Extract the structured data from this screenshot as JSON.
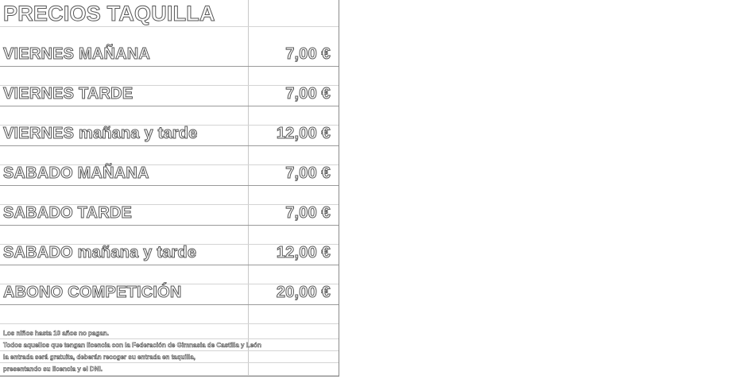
{
  "title": "PRECIOS TAQUILLA",
  "rows": [
    {
      "label": "VIERNES MAÑANA",
      "price": "7,00 €"
    },
    {
      "label": "VIERNES TARDE",
      "price": "7,00 €"
    },
    {
      "label": "VIERNES mañana y tarde",
      "price": "12,00 €"
    },
    {
      "label": "SABADO MAÑANA",
      "price": "7,00 €"
    },
    {
      "label": "SABADO TARDE",
      "price": "7,00 €"
    },
    {
      "label": "SABADO mañana y tarde",
      "price": "12,00 €"
    },
    {
      "label": "ABONO COMPETICIÓN",
      "price": "20,00 €"
    }
  ],
  "notes": [
    "Los niños hasta 10 años no pagan.",
    "Todos aquellos que tengan licencia con la Federación de Gimnasia de Castilla y León",
    "la entrada será gratuita, deberán recoger su entrada en taquilla,",
    "presentando su licencia y el DNI."
  ]
}
